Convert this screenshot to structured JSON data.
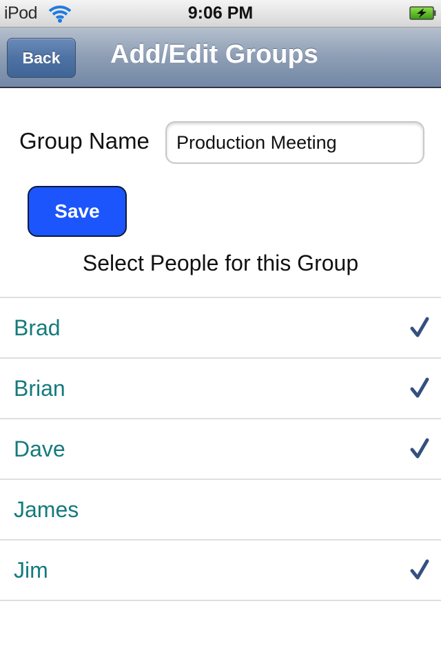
{
  "status_bar": {
    "carrier": "iPod",
    "wifi_icon": "wifi-icon",
    "time": "9:06 PM",
    "battery_icon": "battery-charging-icon"
  },
  "nav_bar": {
    "back_label": "Back",
    "title": "Add/Edit Groups"
  },
  "form": {
    "group_name_label": "Group Name",
    "group_name_value": "Production Meeting",
    "save_label": "Save",
    "select_caption": "Select People for this Group"
  },
  "people": [
    {
      "name": "Brad",
      "selected": true
    },
    {
      "name": "Brian",
      "selected": true
    },
    {
      "name": "Dave",
      "selected": true
    },
    {
      "name": "James",
      "selected": false
    },
    {
      "name": "Jim",
      "selected": true
    }
  ],
  "colors": {
    "accent_blue": "#1b55fb",
    "name_teal": "#157a7d",
    "check_navy": "#34507f"
  }
}
